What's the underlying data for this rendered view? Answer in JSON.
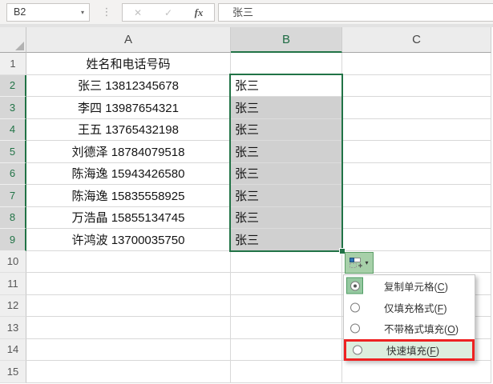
{
  "name_box": {
    "value": "B2",
    "dropdown_icon": "▾"
  },
  "formula_bar": {
    "value": "张三"
  },
  "toolbar": {
    "cancel_icon": "✕",
    "confirm_icon": "✓",
    "fx_icon": "fx",
    "gripper_icon": "⋮"
  },
  "grid": {
    "columns": [
      {
        "letter": "A",
        "selected": false
      },
      {
        "letter": "B",
        "selected": true
      },
      {
        "letter": "C",
        "selected": false
      }
    ],
    "rows": [
      {
        "num": "1",
        "a": "姓名和电话号码",
        "b": "",
        "selected": false,
        "b_fill": false
      },
      {
        "num": "2",
        "a": "张三 13812345678",
        "b": "张三",
        "selected": true,
        "b_fill": false
      },
      {
        "num": "3",
        "a": "李四 13987654321",
        "b": "张三",
        "selected": true,
        "b_fill": true
      },
      {
        "num": "4",
        "a": "王五 13765432198",
        "b": "张三",
        "selected": true,
        "b_fill": true
      },
      {
        "num": "5",
        "a": "刘德泽 18784079518",
        "b": "张三",
        "selected": true,
        "b_fill": true
      },
      {
        "num": "6",
        "a": "陈海逸 15943426580",
        "b": "张三",
        "selected": true,
        "b_fill": true
      },
      {
        "num": "7",
        "a": "陈海逸 15835558925",
        "b": "张三",
        "selected": true,
        "b_fill": true
      },
      {
        "num": "8",
        "a": "万浩晶 15855134745",
        "b": "张三",
        "selected": true,
        "b_fill": true
      },
      {
        "num": "9",
        "a": "许鸿波 13700035750",
        "b": "张三",
        "selected": true,
        "b_fill": true
      },
      {
        "num": "10",
        "a": "",
        "b": "",
        "selected": false,
        "b_fill": false
      },
      {
        "num": "11",
        "a": "",
        "b": "",
        "selected": false,
        "b_fill": false
      },
      {
        "num": "12",
        "a": "",
        "b": "",
        "selected": false,
        "b_fill": false
      },
      {
        "num": "13",
        "a": "",
        "b": "",
        "selected": false,
        "b_fill": false
      },
      {
        "num": "14",
        "a": "",
        "b": "",
        "selected": false,
        "b_fill": false
      },
      {
        "num": "15",
        "a": "",
        "b": "",
        "selected": false,
        "b_fill": false
      }
    ],
    "selected_range": "B2:B9"
  },
  "autofill": {
    "button_arrow_icon": "▾",
    "menu_items": [
      {
        "id": "copy-cells",
        "text": "复制单元格",
        "hotkey": "C",
        "radio_selected": true,
        "highlighted": false
      },
      {
        "id": "fill-formatting-only",
        "text": "仅填充格式",
        "hotkey": "F",
        "radio_selected": false,
        "highlighted": false
      },
      {
        "id": "fill-without-formatting",
        "text": "不带格式填充",
        "hotkey": "O",
        "radio_selected": false,
        "highlighted": false
      },
      {
        "id": "flash-fill",
        "text": "快速填充",
        "hotkey": "F",
        "radio_selected": false,
        "highlighted": true
      }
    ]
  },
  "colors": {
    "excel_green": "#217346",
    "selected_fill_gray": "#d0d0d0",
    "highlight_red": "#ee2222",
    "menu_highlight_green": "#ddeede",
    "autofill_button_green": "#a7d0a9"
  }
}
